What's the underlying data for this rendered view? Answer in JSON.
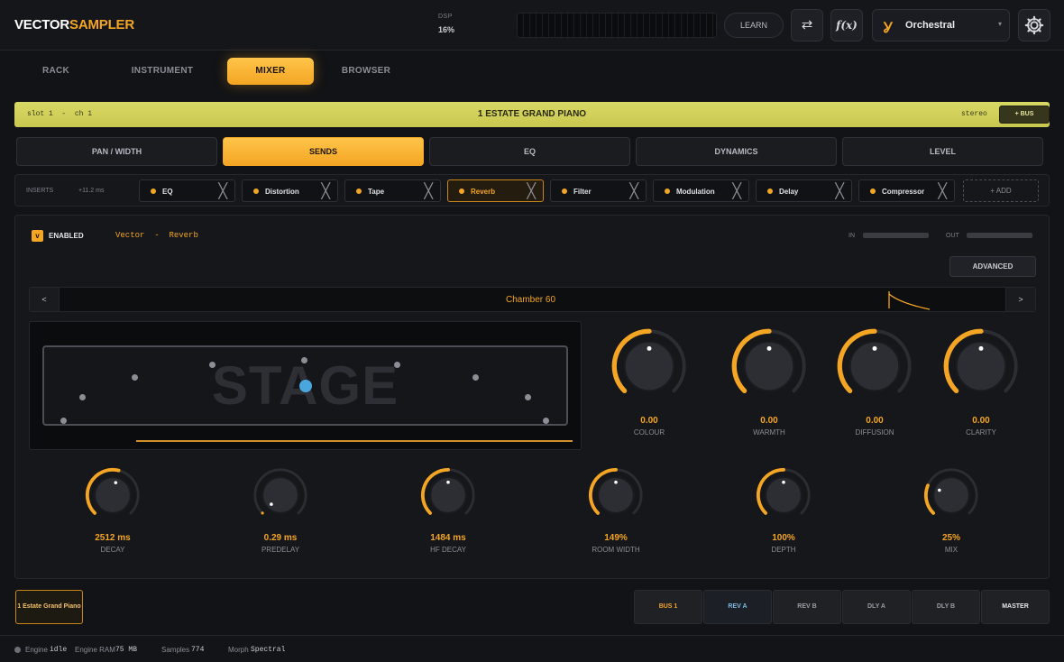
{
  "header": {
    "logo_a": "VECTOR",
    "logo_b": "SAMPLER",
    "dsp_label": "DSP",
    "dsp_value": "16%",
    "learn_label": "LEARN",
    "swap_icon": "swap-icon",
    "fx_icon": "fx-icon",
    "fx_label": "f(x)",
    "preset_name": "Orchestral",
    "settings_icon": "gear-icon"
  },
  "nav": {
    "tabs": [
      "RACK",
      "INSTRUMENT",
      "MIXER",
      "BROWSER"
    ],
    "active": "MIXER"
  },
  "slot_bar": {
    "slot": "slot 1",
    "sep": "-",
    "channel": "ch 1",
    "name": "1 ESTATE GRAND PIANO",
    "mode": "stereo",
    "bus_button": "+ BUS"
  },
  "subtabs": {
    "items": [
      "PAN / WIDTH",
      "SENDS",
      "EQ",
      "DYNAMICS",
      "LEVEL"
    ],
    "active": "SENDS"
  },
  "inserts": {
    "label": "INSERTS",
    "latency": "+11.2 ms",
    "slots": [
      "EQ",
      "Distortion",
      "Tape",
      "Reverb",
      "Filter",
      "Modulation",
      "Delay",
      "Compressor"
    ],
    "active": "Reverb",
    "add_label": "+ ADD"
  },
  "effect": {
    "enabled_label": "ENABLED",
    "vendor": "Vector",
    "sep": "-",
    "name": "Reverb",
    "in_label": "IN",
    "out_label": "OUT",
    "advanced_label": "ADVANCED",
    "preset_prev": "<",
    "preset_next": ">",
    "preset_name": "Chamber 60",
    "stage_label": "STAGE"
  },
  "knobs_top": [
    {
      "label": "COLOUR",
      "value": "0.00",
      "level": 0.5
    },
    {
      "label": "WARMTH",
      "value": "0.00",
      "level": 0.5
    },
    {
      "label": "DIFFUSION",
      "value": "0.00",
      "level": 0.5
    },
    {
      "label": "CLARITY",
      "value": "0.00",
      "level": 0.5
    }
  ],
  "knobs_bottom": [
    {
      "label": "DECAY",
      "value": "2512 ms",
      "level": 0.55
    },
    {
      "label": "PREDELAY",
      "value": "0.29 ms",
      "level": 0.0
    },
    {
      "label": "HF DECAY",
      "value": "1484 ms",
      "level": 0.5
    },
    {
      "label": "ROOM WIDTH",
      "value": "149%",
      "level": 0.5
    },
    {
      "label": "DEPTH",
      "value": "100%",
      "level": 0.5
    },
    {
      "label": "MIX",
      "value": "25%",
      "level": 0.25
    }
  ],
  "footer": {
    "channel_chip": "1 Estate Grand Piano",
    "buses": [
      "BUS 1",
      "REV A",
      "REV B",
      "DLY A",
      "DLY B",
      "MASTER"
    ]
  },
  "status": {
    "engine_label": "Engine",
    "engine_value": "idle",
    "ram_label": "Engine RAM",
    "ram_value": "75 MB",
    "samples_label": "Samples",
    "samples_value": "774",
    "morph_label": "Morph",
    "morph_value": "Spectral"
  },
  "colors": {
    "accent": "#f4a523",
    "slot_bar": "#d8d865",
    "source_dot": "#4aa7de"
  }
}
